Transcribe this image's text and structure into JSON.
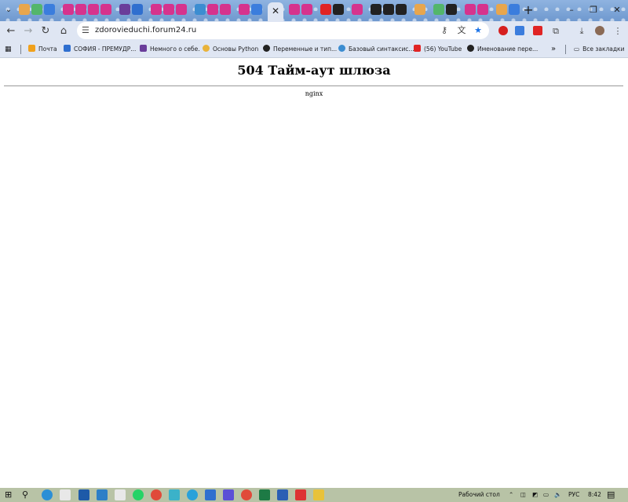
{
  "browser": {
    "window_controls": {
      "minimize": "–",
      "restore": "❐",
      "close": "✕"
    },
    "tab_list_icon": "chevron-down-icon",
    "active_tab_close": "✕",
    "new_tab": "+",
    "address": "zdorovieduchi.forum24.ru",
    "nav": {
      "back": "←",
      "forward": "→",
      "reload": "↻",
      "home": "⌂"
    },
    "bookmarks": [
      {
        "label": "Почта",
        "color": "#f0a11c"
      },
      {
        "label": "СОФИЯ - ПРЕМУДР...",
        "color": "#2f6fcf"
      },
      {
        "label": "Немного о себе.",
        "color": "#6a3d9a"
      },
      {
        "label": "Основы Python",
        "color": "#e9b33a"
      },
      {
        "label": "Переменные и тип...",
        "color": "#222222"
      },
      {
        "label": "Базовый синтаксис...",
        "color": "#3c8dd1"
      },
      {
        "label": "(56) YouTube",
        "color": "#e02424"
      },
      {
        "label": "Именование пере...",
        "color": "#222222"
      }
    ],
    "bookmarks_overflow": "»",
    "all_bookmarks": "Все закладки"
  },
  "page": {
    "title": "504 Тайм-аут шлюза",
    "server": "nginx"
  },
  "taskbar": {
    "desktop_label": "Рабочий стол",
    "language": "РУС",
    "time": "8:42"
  }
}
